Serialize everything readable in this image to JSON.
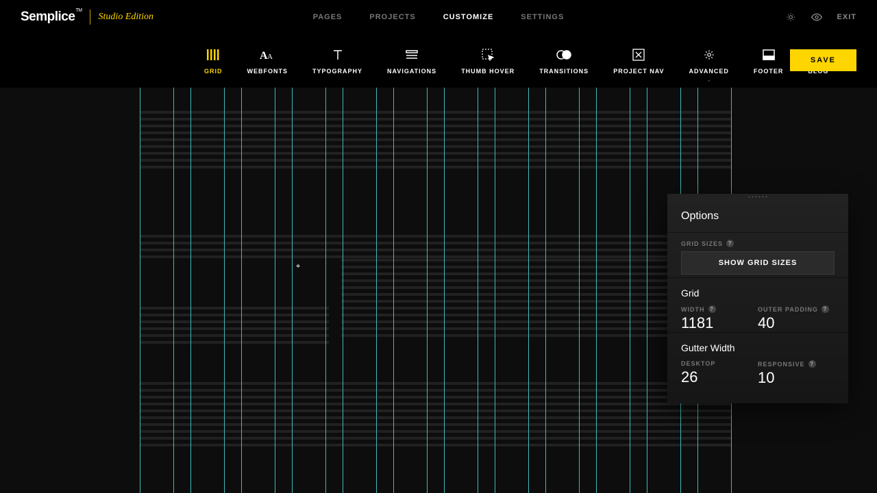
{
  "brand": {
    "name": "Semplice",
    "tm": "TM",
    "edition": "Studio Edition"
  },
  "topnav": {
    "pages": "PAGES",
    "projects": "PROJECTS",
    "customize": "CUSTOMIZE",
    "settings": "SETTINGS",
    "exit": "EXIT"
  },
  "toolbar": {
    "grid": "GRID",
    "webfonts": "WEBFONTS",
    "typography": "TYPOGRAPHY",
    "navigations": "NAVIGATIONS",
    "thumbhover": "THUMB HOVER",
    "transitions": "TRANSITIONS",
    "projectnav": "PROJECT NAV",
    "advanced": "ADVANCED",
    "footer": "FOOTER",
    "blog": "BLOG",
    "save": "SAVE"
  },
  "panel": {
    "title": "Options",
    "gridsizes_label": "GRID SIZES",
    "show_sizes": "SHOW GRID SIZES",
    "grid_title": "Grid",
    "width_label": "WIDTH",
    "width_value": "1181",
    "outerpad_label": "OUTER PADDING",
    "outerpad_value": "40",
    "gutter_title": "Gutter Width",
    "desktop_label": "DESKTOP",
    "desktop_value": "26",
    "responsive_label": "RESPONSIVE",
    "responsive_value": "10"
  }
}
